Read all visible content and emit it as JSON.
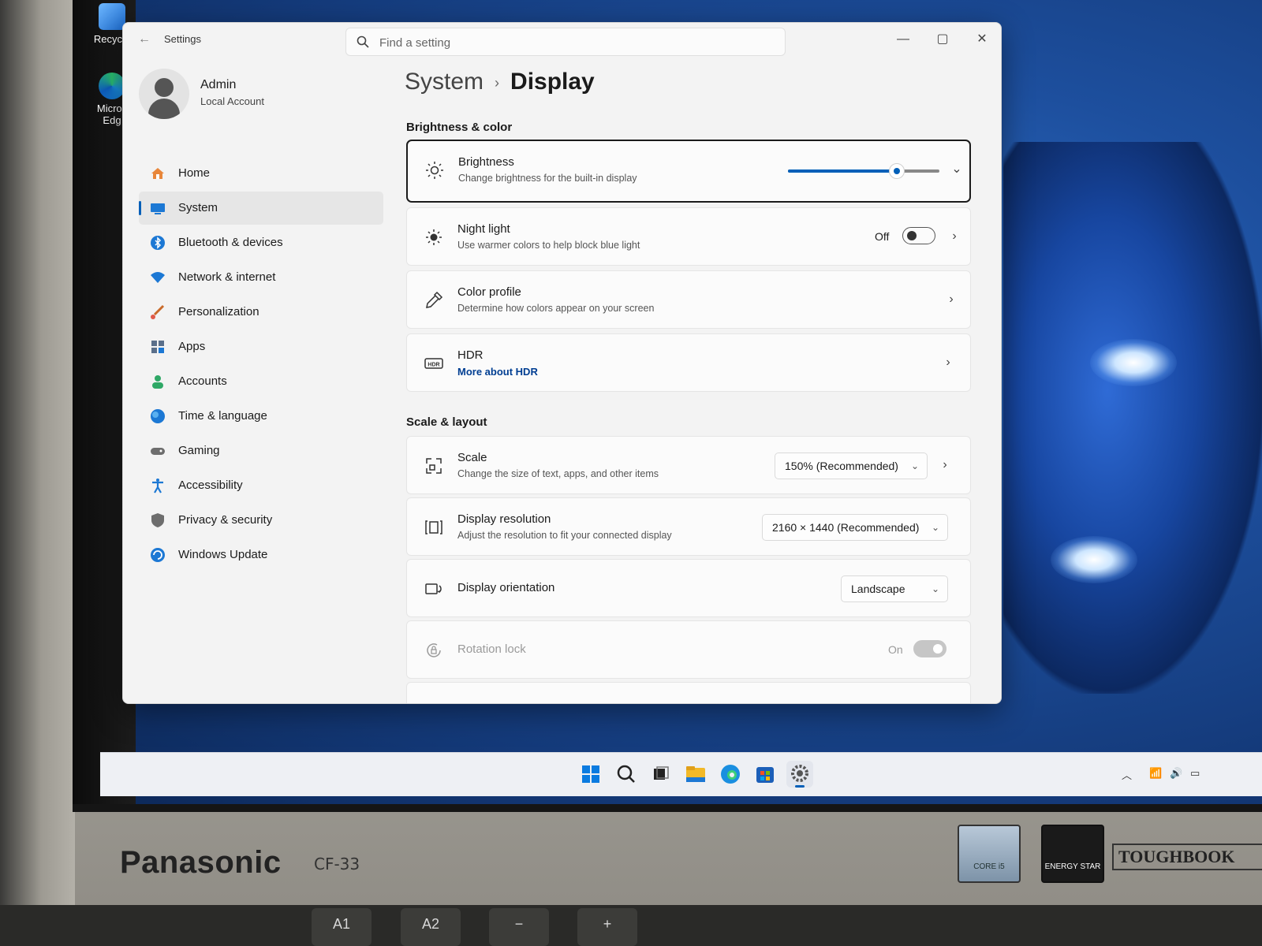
{
  "window": {
    "app_title": "Settings",
    "search_placeholder": "Find a setting"
  },
  "user": {
    "name": "Admin",
    "account_type": "Local Account"
  },
  "sidebar": {
    "items": [
      {
        "label": "Home",
        "icon": "home-icon",
        "active": false
      },
      {
        "label": "System",
        "icon": "system-icon",
        "active": true
      },
      {
        "label": "Bluetooth & devices",
        "icon": "bluetooth-icon",
        "active": false
      },
      {
        "label": "Network & internet",
        "icon": "wifi-icon",
        "active": false
      },
      {
        "label": "Personalization",
        "icon": "brush-icon",
        "active": false
      },
      {
        "label": "Apps",
        "icon": "apps-icon",
        "active": false
      },
      {
        "label": "Accounts",
        "icon": "person-icon",
        "active": false
      },
      {
        "label": "Time & language",
        "icon": "globe-icon",
        "active": false
      },
      {
        "label": "Gaming",
        "icon": "gamepad-icon",
        "active": false
      },
      {
        "label": "Accessibility",
        "icon": "accessibility-icon",
        "active": false
      },
      {
        "label": "Privacy & security",
        "icon": "shield-icon",
        "active": false
      },
      {
        "label": "Windows Update",
        "icon": "update-icon",
        "active": false
      }
    ]
  },
  "breadcrumb": {
    "parent": "System",
    "separator": "›",
    "current": "Display"
  },
  "sections": {
    "brightness_color": "Brightness & color",
    "scale_layout": "Scale & layout"
  },
  "settings": {
    "brightness": {
      "title": "Brightness",
      "subtitle": "Change brightness for the built-in display",
      "level": 0.72
    },
    "night_light": {
      "title": "Night light",
      "subtitle": "Use warmer colors to help block blue light",
      "state_label": "Off"
    },
    "color_profile": {
      "title": "Color profile",
      "subtitle": "Determine how colors appear on your screen"
    },
    "hdr": {
      "title": "HDR",
      "link": "More about HDR"
    },
    "scale": {
      "title": "Scale",
      "subtitle": "Change the size of text, apps, and other items",
      "value": "150% (Recommended)"
    },
    "resolution": {
      "title": "Display resolution",
      "subtitle": "Adjust the resolution to fit your connected display",
      "value": "2160 × 1440 (Recommended)"
    },
    "orientation": {
      "title": "Display orientation",
      "value": "Landscape"
    },
    "rotation_lock": {
      "title": "Rotation lock",
      "state_label": "On"
    }
  },
  "taskbar": {
    "icons": [
      "windows-start-icon",
      "search-icon",
      "task-view-icon",
      "file-explorer-icon",
      "edge-icon",
      "store-icon",
      "settings-icon"
    ]
  },
  "desktop": {
    "icons": [
      {
        "label": "Recycle"
      },
      {
        "label": "Micros Edg"
      }
    ]
  },
  "hardware": {
    "brand": "Panasonic",
    "model": "CF-33",
    "intel_badge": "CORE i5",
    "energy_badge": "ENERGY STAR",
    "toughbook": "TOUGHBOOK",
    "keys": [
      "A1",
      "A2",
      "−",
      "+"
    ]
  },
  "colors": {
    "accent": "#005fb8",
    "window_bg": "#f3f3f3",
    "card_bg": "#fbfbfb"
  }
}
